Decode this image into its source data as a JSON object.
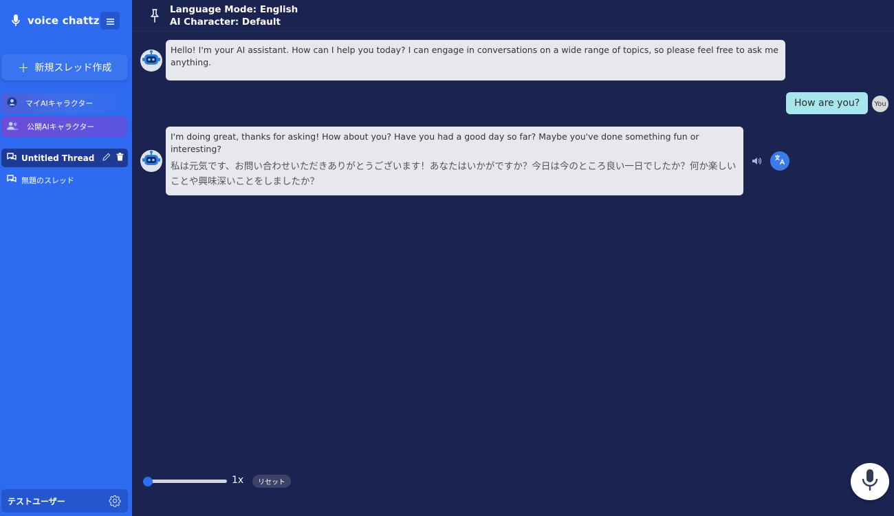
{
  "app": {
    "name": "voice chattz"
  },
  "sidebar": {
    "new_thread_label": "新規スレッド作成",
    "characters": [
      {
        "label": "マイAIキャラクター",
        "icon": "user-circle-icon"
      },
      {
        "label": "公開AIキャラクター",
        "icon": "users-icon"
      }
    ],
    "threads": [
      {
        "label": "Untitled Thread",
        "active": true
      },
      {
        "label": "無題のスレッド",
        "active": false
      }
    ],
    "user_name": "テストユーザー"
  },
  "header": {
    "language_mode": "Language Mode: English",
    "ai_character": "AI Character: Default"
  },
  "messages": [
    {
      "role": "assistant",
      "text": "Hello! I'm your AI assistant. How can I help you today? I can engage in conversations on a wide range of topics, so please feel free to ask me anything."
    },
    {
      "role": "user",
      "text": "How are you?",
      "badge": "You"
    },
    {
      "role": "assistant",
      "text": "I'm doing great, thanks for asking! How about you? Have you had a good day so far? Maybe you've done something fun or interesting?",
      "translation": "私は元気です、お問い合わせいただきありがとうございます！あなたはいかがですか？今日は今のところ良い一日でしたか？何か楽しいことや興味深いことをしましたか？"
    }
  ],
  "controls": {
    "speed_value": 0,
    "speed_label": "1x",
    "reset_label": "リセット"
  },
  "colors": {
    "sidebar": "#2f6bf0",
    "main_bg": "#1b2350",
    "assistant_bubble": "#e7e8ee",
    "user_bubble": "#a7e6ec",
    "accent": "#3b7be9"
  }
}
